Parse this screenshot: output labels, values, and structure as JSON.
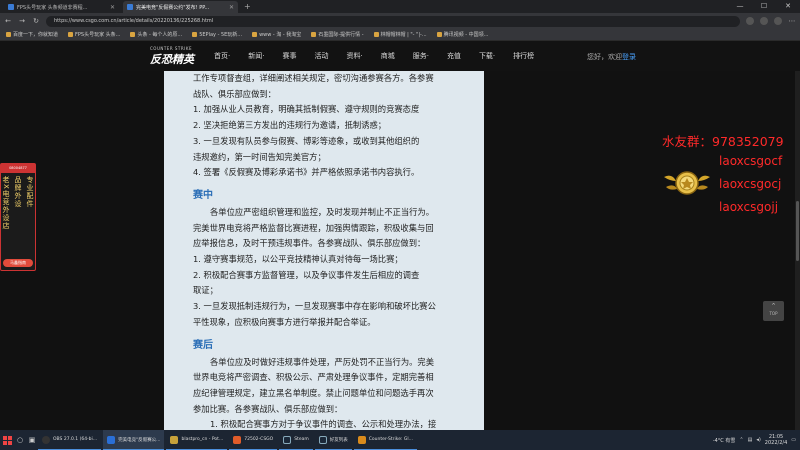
{
  "browser": {
    "tabs": [
      {
        "title": "FPS头号玩家 头条频道非赛程..."
      },
      {
        "title": "完美电竞\"反假赛公约\"发布! PP..."
      }
    ],
    "url": "https://www.csgo.com.cn/article/details/20220136/225268.html",
    "bookmarks": [
      "百度一下，你就知道",
      "FPS头号玩家 头条...",
      "头条 - 每个人的原...",
      "5EPlay - 5E玩新...",
      "www - 淘 - 我淘宝",
      "石墨国际-提供行情 -",
      "林帽帽林帽 | \"- \"|-...",
      "腾讯视频 - 中国领..."
    ]
  },
  "site": {
    "logo_sub": "COUNTER STRIKE",
    "logo_main": "反恐精英",
    "menu": [
      "首页·",
      "新闻·",
      "赛事",
      "活动",
      "资料·",
      "商城",
      "服务·",
      "充值",
      "下载·",
      "排行榜"
    ],
    "greeting": "您好，欢迎",
    "login": "登录"
  },
  "article": {
    "intro_lines": [
      "工作专项督查组，详细阐述相关规定，密切沟通参赛各方。各参赛",
      "战队、俱乐部应做到："
    ],
    "pre_list": [
      "1. 加强从业人员教育，明确其抵制假赛、遵守规则的竞赛态度",
      "2. 坚决拒绝第三方发出的违规行为邀请，抵制诱惑；",
      "3. 一旦发现有队员参与假赛、博彩等迹象，或收到其他组织的",
      "违规邀约，第一时间告知完美官方；",
      "4. 签署《反假赛及博彩承诺书》并严格依照承诺书内容执行。"
    ],
    "mid_title": "赛中",
    "mid_para": [
      "各单位应严密组织管理和监控，及时发现并制止不正当行为。",
      "完美世界电竞将严格监督比赛进程，加强舆情跟踪，积极收集与回",
      "应举报信息，及时干预违规事件。各参赛战队、俱乐部应做到："
    ],
    "mid_list": [
      "1. 遵守赛事规范，以公平竞技精神认真对待每一场比赛；",
      "2. 积极配合赛事方监督管理，以及争议事件发生后相应的调查",
      "取证；",
      "3. 一旦发现抵制违规行为，一旦发现赛事中存在影响和破坏比赛公",
      "平性现象，应积极向赛事方进行举报并配合举证。"
    ],
    "post_title": "赛后",
    "post_para": [
      "各单位应及时做好违规事件处理，严厉处罚不正当行为。完美",
      "世界电竞将严密调查、积极公示、严肃处理争议事件，定期完善相",
      "应纪律管理规定，建立黑名单制度。禁止问题单位和问题选手再次",
      "参加比赛。各参赛战队、俱乐部应做到："
    ],
    "post_list": [
      "1. 积极配合赛事方对于争议事件的调查、公示和处理办法，接"
    ]
  },
  "side_banner": {
    "top": "08004877",
    "col1": "品牌外设",
    "col2": "专业配件",
    "col3": "老X电竞外设店",
    "button": "马鑫指南"
  },
  "overlay": {
    "qq": "水友群：978352079",
    "ids": [
      "laoxcsgocf",
      "laoxcsgocj",
      "laoxcsgojj"
    ]
  },
  "top_button": "TOP",
  "taskbar": {
    "tasks": [
      {
        "label": "OBS 27.0.1 (64-bi...",
        "color": "#333"
      },
      {
        "label": "完美电竞\"反假赛公...",
        "color": "#2a6fd6"
      },
      {
        "label": "blastpro_cn - Pot...",
        "color": "#c7a23a"
      },
      {
        "label": "72502-CSGO",
        "color": "#e05c2a"
      },
      {
        "label": "Steam",
        "color": "#1b2838"
      },
      {
        "label": "好友列表",
        "color": "#1b2838"
      },
      {
        "label": "Counter-Strike: Gl...",
        "color": "#d98b1c"
      }
    ],
    "weather": "-4°C 有雪",
    "time": "21:05",
    "date": "2022/2/4"
  }
}
